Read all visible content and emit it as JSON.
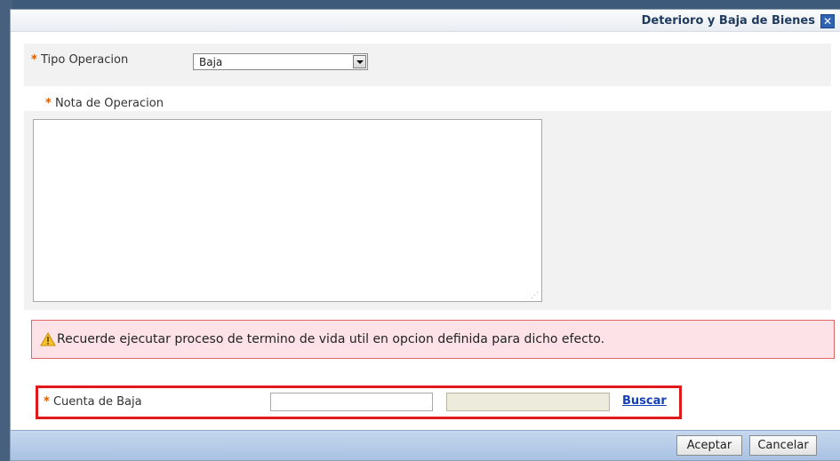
{
  "dialog": {
    "title": "Deterioro y Baja de Bienes",
    "close_icon": "close-icon"
  },
  "form": {
    "required_mark": "*",
    "tipo_operacion": {
      "label": "Tipo Operacion",
      "value": "Baja"
    },
    "nota_operacion": {
      "label": "Nota de Operacion",
      "value": ""
    },
    "cuenta_baja": {
      "label": "Cuenta de Baja",
      "code_value": "",
      "description_value": "",
      "search_link": "Buscar"
    }
  },
  "warning": {
    "icon": "warning-icon",
    "text": "Recuerde ejecutar proceso de termino de vida util en opcion definida para dicho efecto."
  },
  "footer": {
    "accept_label": "Aceptar",
    "cancel_label": "Cancelar"
  },
  "colors": {
    "title": "#1f3a5f",
    "required": "#e05a00",
    "warning_bg": "#fde3e8",
    "warning_border": "#e06565",
    "highlight_border": "#e0191b",
    "link": "#1540b8"
  }
}
